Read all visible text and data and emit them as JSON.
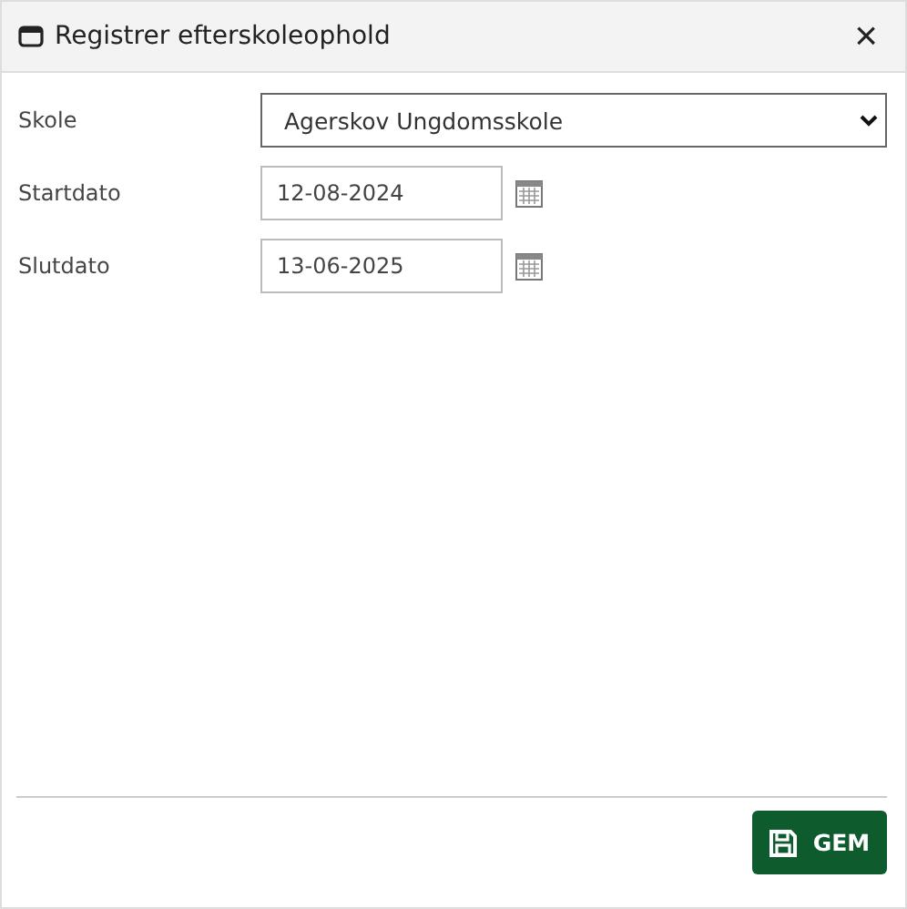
{
  "dialog": {
    "title": "Registrer efterskoleophold",
    "close": "×"
  },
  "fields": [
    {
      "kind": "select",
      "label": "Skole",
      "value": "Agerskov Ungdomsskole"
    },
    {
      "kind": "date",
      "label": "Startdato",
      "value": "12-08-2024"
    },
    {
      "kind": "date",
      "label": "Slutdato",
      "value": "13-06-2025"
    }
  ],
  "buttons": [
    {
      "label": "GEM"
    }
  ]
}
